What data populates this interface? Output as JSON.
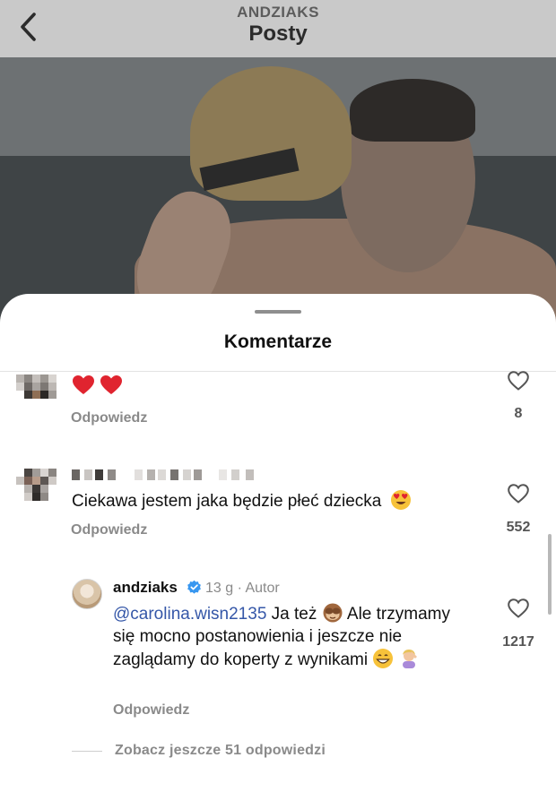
{
  "header": {
    "username": "ANDZIAKS",
    "title": "Posty",
    "back_icon": "chevron-left-icon"
  },
  "sheet": {
    "title": "Komentarze"
  },
  "comments": [
    {
      "text": "❤️❤️",
      "reply_label": "Odpowiedz",
      "like_count": "8",
      "like_icon": "heart-outline-icon"
    },
    {
      "text": "Ciekawa jestem jaka będzie płeć dziecka",
      "emoji": "heart-eyes-emoji",
      "reply_label": "Odpowiedz",
      "like_count": "552",
      "like_icon": "heart-outline-icon"
    }
  ],
  "reply": {
    "username": "andziaks",
    "time": "13 g",
    "separator": "·",
    "badge": "Autor",
    "mention": "@carolina.wisn2135",
    "text_part1": "Ja też",
    "text_part2": "Ale trzymamy się mocno postanowienia i jeszcze nie zaglądamy do koperty z wynikami",
    "reply_label": "Odpowiedz",
    "like_count": "1217",
    "like_icon": "heart-outline-icon"
  },
  "more_replies": "Zobacz jeszcze 51 odpowiedzi",
  "colors": {
    "header_bg": "#c9c9c9",
    "mention": "#3557a8",
    "heart_red": "#e0242f",
    "verified_blue": "#3897f0",
    "muted_text": "#8a8a8a"
  }
}
